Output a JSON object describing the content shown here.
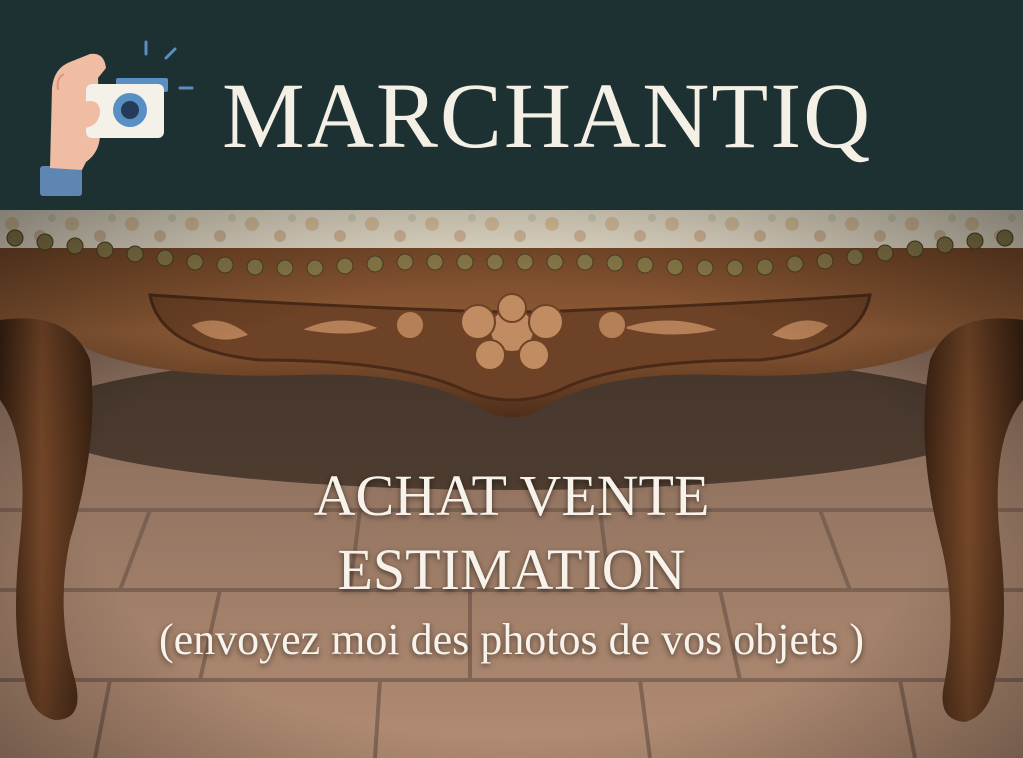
{
  "brand": {
    "name": "MARCHANTIQ",
    "logo_icon": "hand-camera-icon"
  },
  "tagline": {
    "line1": "ACHAT VENTE",
    "line2": "ESTIMATION",
    "line3": "(envoyez moi des photos de vos objets )"
  },
  "colors": {
    "header_bg": "#1e3132",
    "text_light": "#f4f0e6",
    "wood": "#6b3f22",
    "tile": "#a88670"
  }
}
